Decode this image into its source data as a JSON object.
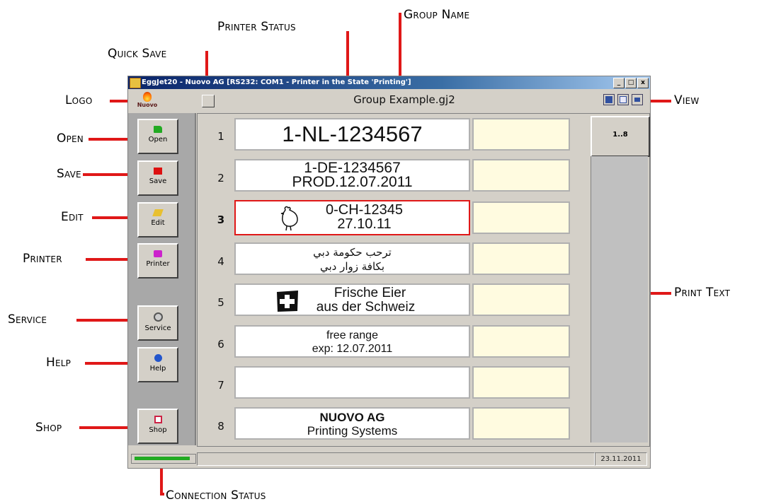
{
  "callouts": {
    "printer_status": "Printer Status",
    "group_name": "Group Name",
    "quick_save": "Quick Save",
    "logo": "Logo",
    "view": "View",
    "open": "Open",
    "save": "Save",
    "edit": "Edit",
    "printer": "Printer",
    "service": "Service",
    "help": "Help",
    "shop": "Shop",
    "print_text": "Print Text",
    "connection_status": "Connection Status"
  },
  "window": {
    "title": "EggJet20 - Nuovo AG   [RS232: COM1 - Printer in the State 'Printing']",
    "controls": [
      "_",
      "□",
      "x"
    ],
    "logo_text": "Nuovo",
    "group_name": "Group Example.gj2"
  },
  "toolbar": {
    "buttons": [
      {
        "label": "Open",
        "icon": "folder-icon",
        "color": "#22aa22"
      },
      {
        "label": "Save",
        "icon": "save-icon",
        "color": "#dd1010"
      },
      {
        "label": "Edit",
        "icon": "edit-icon",
        "color": "#e8c030"
      },
      {
        "label": "Printer",
        "icon": "printer-icon",
        "color": "#cc22cc"
      },
      {
        "label": "Service",
        "icon": "gear-icon",
        "color": "#555555"
      },
      {
        "label": "Help",
        "icon": "help-icon",
        "color": "#2255cc"
      },
      {
        "label": "Shop",
        "icon": "shop-icon",
        "color": "#cc2244"
      }
    ]
  },
  "rows": [
    {
      "num": "1",
      "line1": "1-NL-1234567",
      "line2": ""
    },
    {
      "num": "2",
      "line1": "1-DE-1234567",
      "line2": "PROD.12.07.2011"
    },
    {
      "num": "3",
      "line1": "0-CH-12345",
      "line2": "27.10.11"
    },
    {
      "num": "4",
      "line1": "ترحب حكومة دبي",
      "line2": "بكافة زوار دبي"
    },
    {
      "num": "5",
      "line1": "Frische Eier",
      "line2": "aus der Schweiz"
    },
    {
      "num": "6",
      "line1": "free range",
      "line2": "exp: 12.07.2011"
    },
    {
      "num": "7",
      "line1": "",
      "line2": ""
    },
    {
      "num": "8",
      "line1": "NUOVO AG",
      "line2": "Printing Systems"
    }
  ],
  "group_selector": "1..8",
  "status": {
    "connection_color": "#22aa22",
    "date": "23.11.2011"
  }
}
